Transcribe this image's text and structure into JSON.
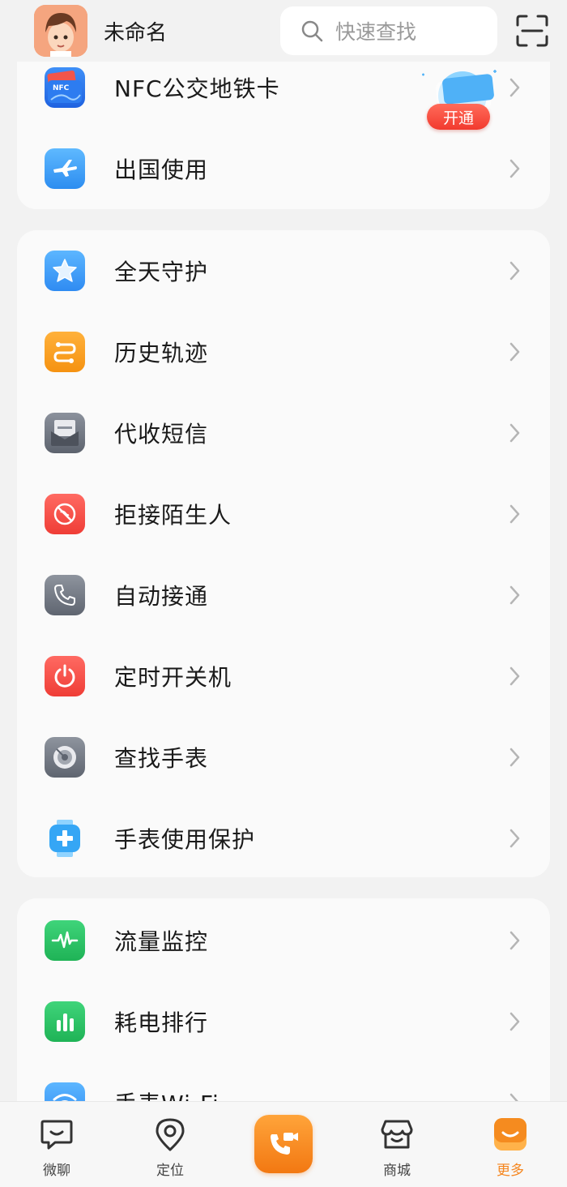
{
  "header": {
    "username": "未命名",
    "search_placeholder": "快速查找"
  },
  "section1": {
    "items": [
      {
        "label": "NFC公交地铁卡",
        "icon": "nfc-card-icon",
        "promo_badge": "开通"
      },
      {
        "label": "出国使用",
        "icon": "airplane-icon"
      }
    ]
  },
  "section2": {
    "items": [
      {
        "label": "全天守护",
        "icon": "star-icon"
      },
      {
        "label": "历史轨迹",
        "icon": "route-icon"
      },
      {
        "label": "代收短信",
        "icon": "message-inbox-icon"
      },
      {
        "label": "拒接陌生人",
        "icon": "block-stranger-icon"
      },
      {
        "label": "自动接通",
        "icon": "phone-icon"
      },
      {
        "label": "定时开关机",
        "icon": "power-icon"
      },
      {
        "label": "查找手表",
        "icon": "radar-icon"
      },
      {
        "label": "手表使用保护",
        "icon": "watch-protect-icon"
      }
    ]
  },
  "section3": {
    "items": [
      {
        "label": "流量监控",
        "icon": "pulse-icon"
      },
      {
        "label": "耗电排行",
        "icon": "bar-chart-icon"
      },
      {
        "label": "手表Wi-Fi",
        "icon": "wifi-icon"
      }
    ]
  },
  "bottom_nav": {
    "items": [
      {
        "label": "微聊",
        "icon": "chat-icon"
      },
      {
        "label": "定位",
        "icon": "location-pin-icon"
      },
      {
        "label": "",
        "icon": "video-call-icon"
      },
      {
        "label": "商城",
        "icon": "store-icon"
      },
      {
        "label": "更多",
        "icon": "more-icon",
        "active": true
      }
    ]
  },
  "colors": {
    "accent": "#f5861f",
    "background": "#f2f2f2",
    "card": "#fafafa"
  }
}
